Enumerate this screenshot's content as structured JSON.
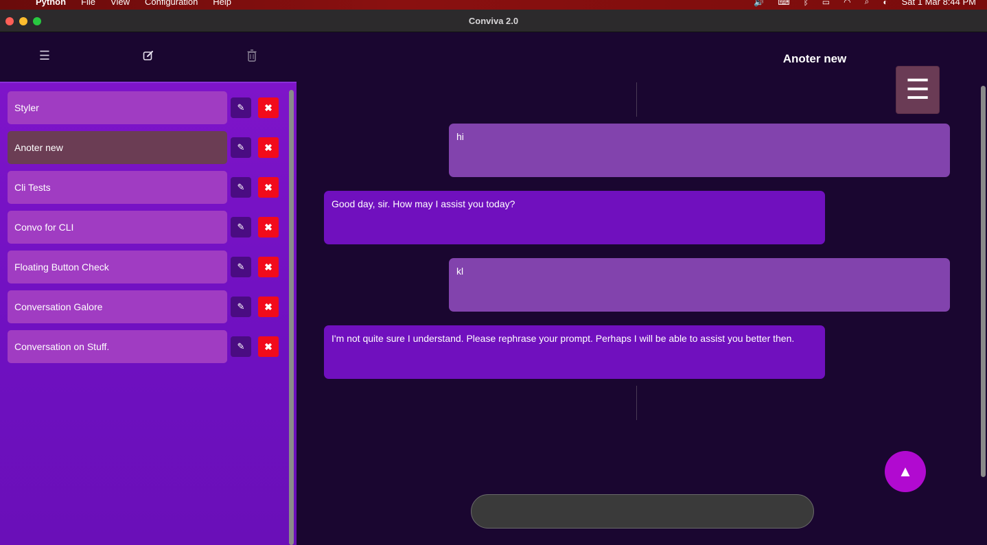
{
  "menubar": {
    "app": "Python",
    "menus": [
      "File",
      "View",
      "Configuration",
      "Help"
    ],
    "datetime": "Sat 1 Mar 8:44 PM"
  },
  "window": {
    "title": "Conviva 2.0"
  },
  "toolbar": {
    "menu_icon": "☰",
    "new_icon": "✎",
    "trash_icon": "🗑"
  },
  "sidebar": {
    "edit_icon": "✎",
    "delete_icon": "✖",
    "conversations": [
      {
        "label": "Styler",
        "active": false
      },
      {
        "label": "Anoter new",
        "active": true
      },
      {
        "label": "Cli Tests",
        "active": false
      },
      {
        "label": "Convo for CLI",
        "active": false
      },
      {
        "label": "Floating Button Check",
        "active": false
      },
      {
        "label": "Conversation Galore",
        "active": false
      },
      {
        "label": "Conversation on Stuff.",
        "active": false
      }
    ]
  },
  "chat": {
    "title": "Anoter new",
    "hamburger_icon": "☰",
    "messages": [
      {
        "role": "user",
        "text": "hi"
      },
      {
        "role": "bot",
        "text": "Good day, sir. How may I assist you today?"
      },
      {
        "role": "user",
        "text": "kl"
      },
      {
        "role": "bot",
        "text": "I'm not quite sure I understand. Please rephrase your prompt. Perhaps I will be able to assist you better then."
      }
    ],
    "send_icon": "▲",
    "input_value": ""
  },
  "colors": {
    "sidebar_bg": "#7e14c9",
    "item_bg": "#a03cc2",
    "item_active_bg": "#6b3d54",
    "user_bubble": "#8243ad",
    "bot_bubble": "#7010be",
    "delete_red": "#f20b1b",
    "send_button": "#b10ad0"
  }
}
